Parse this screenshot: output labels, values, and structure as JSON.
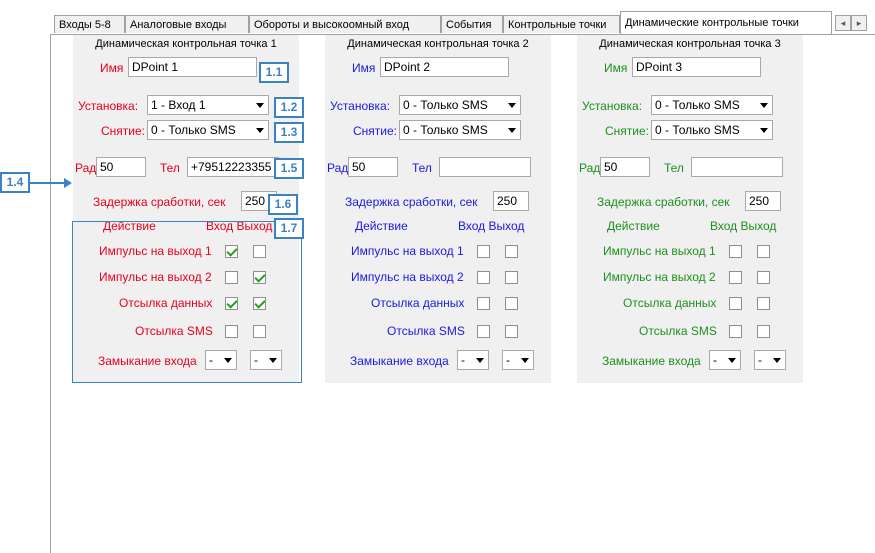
{
  "tabs": [
    {
      "label": "Входы 5-8"
    },
    {
      "label": "Аналоговые входы"
    },
    {
      "label": "Обороты и высокоомный вход"
    },
    {
      "label": "События"
    },
    {
      "label": "Контрольные точки"
    },
    {
      "label": "Динамические контрольные точки"
    }
  ],
  "scroll": {
    "left_icon": "◂",
    "right_icon": "▸"
  },
  "labels": {
    "name": "Имя",
    "install": "Установка:",
    "remove": "Снятие:",
    "radius": "Рад",
    "phone": "Тел",
    "delay": "Задержка сработки, сек",
    "action": "Действие",
    "inout": "Вход Выход",
    "act1": "Импульс на выход 1",
    "act2": "Импульс на выход 2",
    "act3": "Отсылка данных",
    "act4": "Отсылка SMS",
    "act5": "Замыкание входа"
  },
  "groups": [
    {
      "title": "Динамическая контрольная точка 1",
      "name": "DPoint 1",
      "install": "1 - Вход 1",
      "remove": "0 - Только SMS",
      "radius": "50",
      "phone": "+79512223355",
      "delay": "250",
      "checks": [
        [
          true,
          false
        ],
        [
          false,
          true
        ],
        [
          true,
          true
        ],
        [
          false,
          false
        ]
      ],
      "close_in": "-",
      "close_out": "-"
    },
    {
      "title": "Динамическая контрольная точка 2",
      "name": "DPoint 2",
      "install": "0 - Только SMS",
      "remove": "0 - Только SMS",
      "radius": "50",
      "phone": "",
      "delay": "250",
      "checks": [
        [
          false,
          false
        ],
        [
          false,
          false
        ],
        [
          false,
          false
        ],
        [
          false,
          false
        ]
      ],
      "close_in": "-",
      "close_out": "-"
    },
    {
      "title": "Динамическая контрольная точка 3",
      "name": "DPoint 3",
      "install": "0 - Только SMS",
      "remove": "0 - Только SMS",
      "radius": "50",
      "phone": "",
      "delay": "250",
      "checks": [
        [
          false,
          false
        ],
        [
          false,
          false
        ],
        [
          false,
          false
        ],
        [
          false,
          false
        ]
      ],
      "close_in": "-",
      "close_out": "-"
    }
  ],
  "callouts": {
    "c11": "1.1",
    "c12": "1.2",
    "c13": "1.3",
    "c14": "1.4",
    "c15": "1.5",
    "c16": "1.6",
    "c17": "1.7"
  },
  "colors": {
    "group1_labels": "#e8001c",
    "group2_labels": "#1a1ae0",
    "group3_labels": "#1e8f1e",
    "callout": "#3b82c4"
  }
}
